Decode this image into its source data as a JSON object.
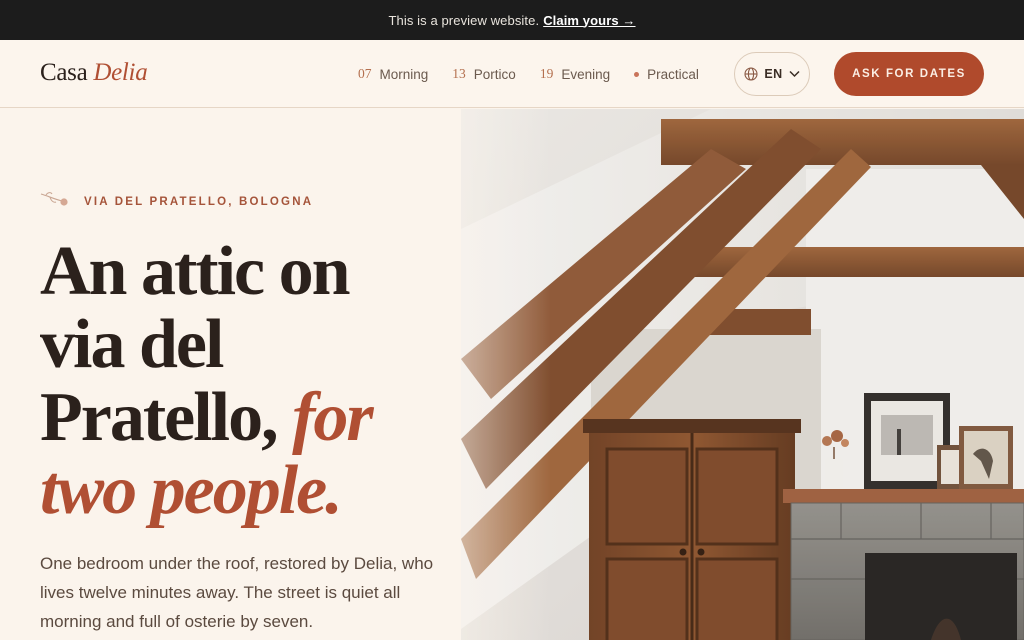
{
  "banner": {
    "text": "This is a preview website.",
    "link": "Claim yours →"
  },
  "header": {
    "logo_main": "Casa",
    "logo_accent": "Delia",
    "nav": [
      {
        "num": "07",
        "label": "Morning"
      },
      {
        "num": "13",
        "label": "Portico"
      },
      {
        "num": "19",
        "label": "Evening"
      },
      {
        "num": "",
        "label": "Practical"
      }
    ],
    "language": "EN",
    "cta": "ASK FOR DATES"
  },
  "hero": {
    "eyebrow": "VIA DEL PRATELLO, BOLOGNA",
    "headline": {
      "line1": "An attic on",
      "line2": "via del",
      "line3_plain": "Pratello, ",
      "line3_italic": "for",
      "line4_italic": "two people."
    },
    "description": "One bedroom under the roof, restored by Delia, who lives twelve minutes away. The street is quiet all morning and full of osterie by seven."
  },
  "colors": {
    "accent": "#b04f33",
    "cta": "#b04a2c",
    "background": "#fbf4ec",
    "banner": "#1c1c1c",
    "text": "#2b211c"
  },
  "icons": {
    "language": "globe-icon",
    "dropdown": "chevron-down-icon",
    "eyebrow": "sprig-icon"
  }
}
